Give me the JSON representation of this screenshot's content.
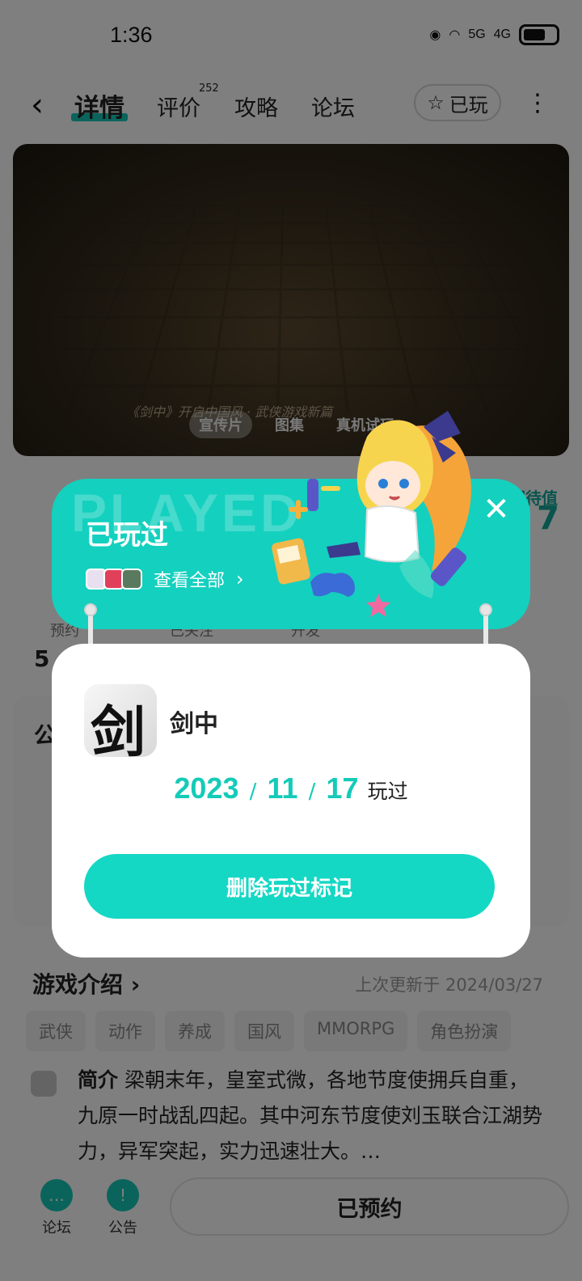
{
  "status_bar": {
    "time": "1:36",
    "network_5g": "5G",
    "network_4g": "4G"
  },
  "nav": {
    "tabs": [
      {
        "label": "详情"
      },
      {
        "label": "评价"
      },
      {
        "label": "攻略"
      },
      {
        "label": "论坛"
      }
    ],
    "review_count": "252",
    "played_label": "已玩"
  },
  "video": {
    "caption": "《剑中》开启中国风 · 武侠游戏新篇",
    "tabs": [
      "宣传片",
      "图集",
      "真机试玩"
    ]
  },
  "game_info": {
    "score_label": "期待值",
    "score_value": "7",
    "stats": [
      "预约",
      "已关注",
      "开发"
    ],
    "stat_number": "5"
  },
  "notice": {
    "title": "公"
  },
  "intro": {
    "title": "游戏介绍",
    "updated": "上次更新于 2024/03/27",
    "tags": [
      "武侠",
      "动作",
      "养成",
      "国风",
      "MMORPG",
      "角色扮演"
    ],
    "summary_label": "简介",
    "summary_text": "梁朝末年，皇室式微，各地节度使拥兵自重，九原一时战乱四起。其中河东节度使刘玉联合江湖势力，异军突起，实力迅速壮大。…"
  },
  "bottom_bar": {
    "forum_label": "论坛",
    "announce_label": "公告",
    "reserved_label": "已预约"
  },
  "popup": {
    "watermark": "PLAYED",
    "title": "已玩过",
    "view_all": "查看全部",
    "game_name": "剑中",
    "game_icon_glyph": "剑",
    "date_year": "2023",
    "date_month": "11",
    "date_day": "17",
    "date_suffix": "玩过",
    "delete_label": "删除玩过标记"
  },
  "colors": {
    "accent": "#14d0bf",
    "accent_dark": "#12a99b",
    "overlay": "rgba(0,0,0,0.5)"
  }
}
